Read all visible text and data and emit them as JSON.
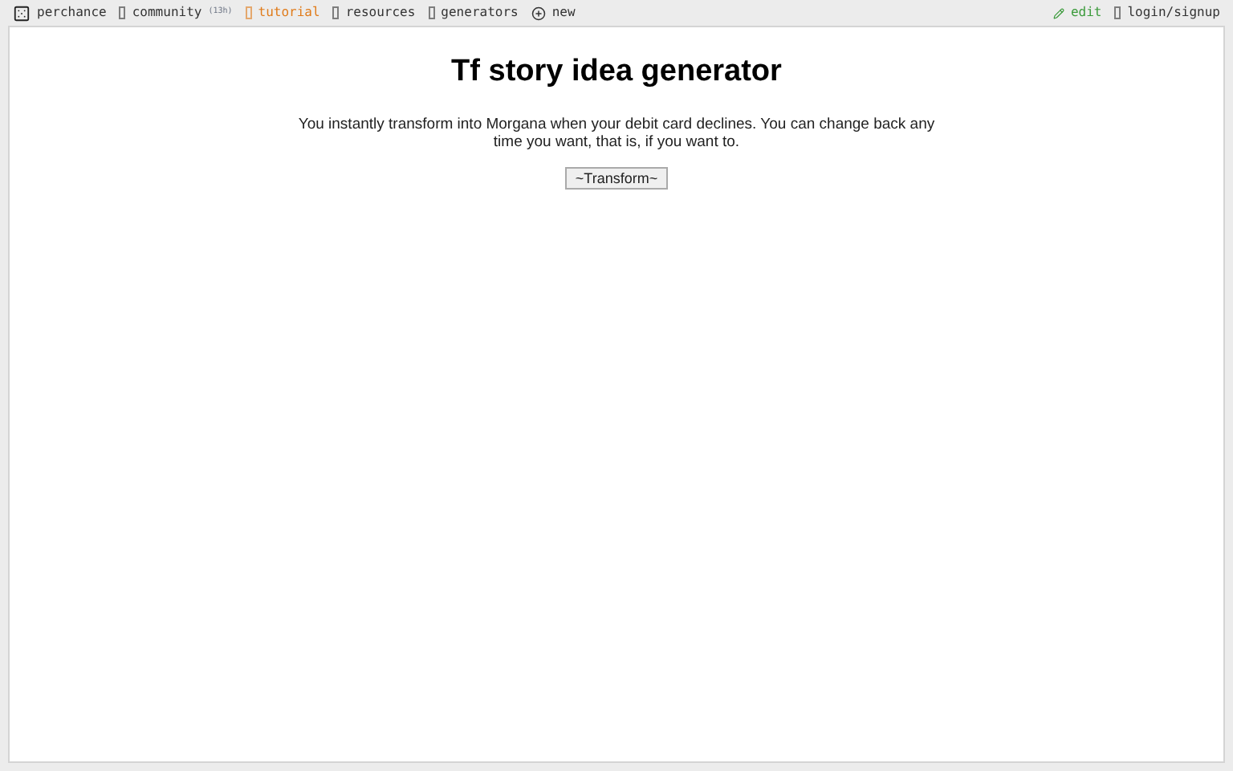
{
  "nav_left": [
    {
      "label": "perchance",
      "kind": "dice",
      "color": "#333333"
    },
    {
      "label": "community",
      "count": "(13h)",
      "kind": "glyph",
      "color": "#333333"
    },
    {
      "label": "tutorial",
      "kind": "glyph",
      "color": "#e07b1a"
    },
    {
      "label": "resources",
      "kind": "glyph",
      "color": "#333333"
    },
    {
      "label": "generators",
      "kind": "glyph",
      "color": "#333333"
    },
    {
      "label": "new",
      "kind": "plus",
      "color": "#333333"
    }
  ],
  "nav_right": [
    {
      "label": "edit",
      "kind": "pencil",
      "color": "#3a9a3a"
    },
    {
      "label": "login/signup",
      "kind": "glyph",
      "color": "#333333"
    }
  ],
  "title": "Tf story idea generator",
  "output": "You instantly transform into Morgana when your debit card declines. You can change back any time you want, that is, if you want to.",
  "button": "~Transform~"
}
